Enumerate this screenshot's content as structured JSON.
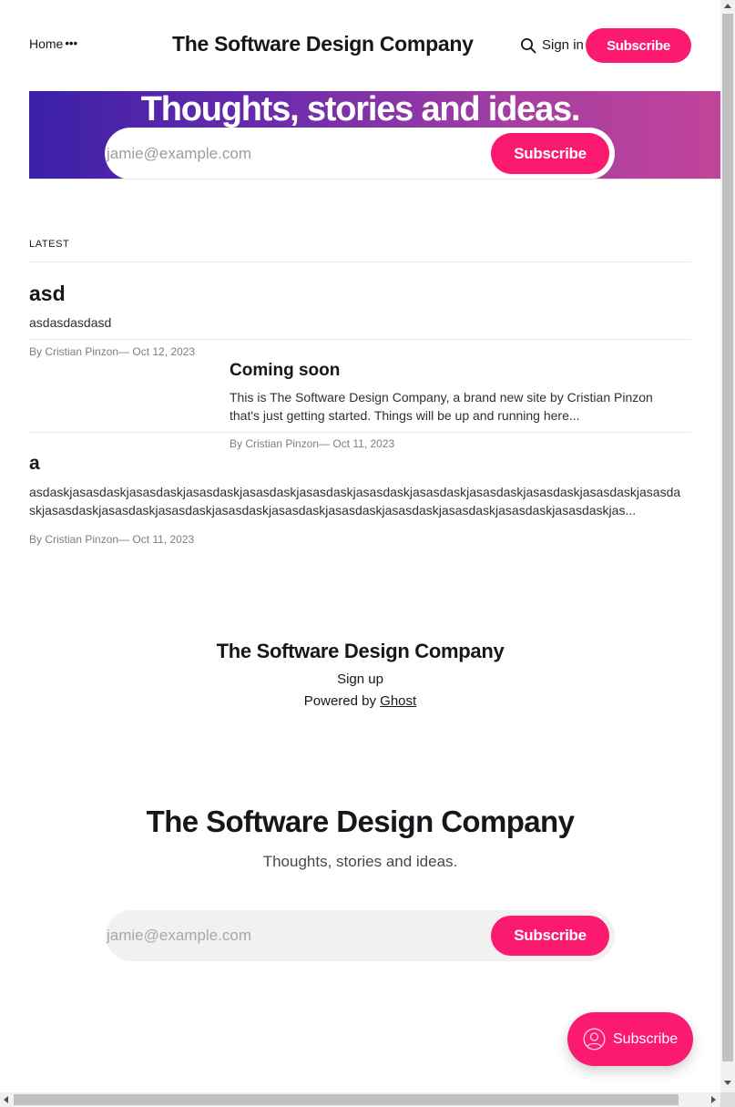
{
  "header": {
    "nav_home": "Home",
    "nav_more": "•••",
    "site_title": "The Software Design Company",
    "search_icon": "search-icon",
    "signin_label": "Sign in",
    "subscribe_label": "Subscribe"
  },
  "hero": {
    "title": "Thoughts, stories and ideas.",
    "email_placeholder": "jamie@example.com",
    "subscribe_label": "Subscribe",
    "gradient_start": "#3a20a8",
    "gradient_end": "#c1449a"
  },
  "feed": {
    "section_label": "LATEST",
    "posts": [
      {
        "title": "asd",
        "excerpt": "asdasdasdasd",
        "meta": "By Cristian Pinzon— Oct 12, 2023"
      },
      {
        "title": "Coming soon",
        "excerpt": "This is The Software Design Company, a brand new site by Cristian Pinzon that's just getting started. Things will be up and running here...",
        "meta": "By Cristian Pinzon— Oct 11, 2023"
      },
      {
        "title": "a",
        "excerpt": "asdaskjasasdaskjasasdaskjasasdaskjasasdaskjasasdaskjasasdaskjasasdaskjasasdaskjasasdaskjasasdaskjasasdaskjasasdaskjasasdaskjasasdaskjasasdaskjasasdaskjasasdaskjasasdaskjasasdaskjasasdaskjasasdaskjas...",
        "meta": "By Cristian Pinzon— Oct 11, 2023"
      }
    ]
  },
  "footer": {
    "site_title": "The Software Design Company",
    "signup_label": "Sign up",
    "powered_prefix": "Powered by ",
    "powered_link": "Ghost"
  },
  "cta": {
    "title": "The Software Design Company",
    "description": "Thoughts, stories and ideas.",
    "email_placeholder": "jamie@example.com",
    "subscribe_label": "Subscribe"
  },
  "portal": {
    "icon": "user-circle-icon",
    "label": "Subscribe"
  },
  "colors": {
    "accent": "#fb1a70",
    "text": "#15171a"
  }
}
